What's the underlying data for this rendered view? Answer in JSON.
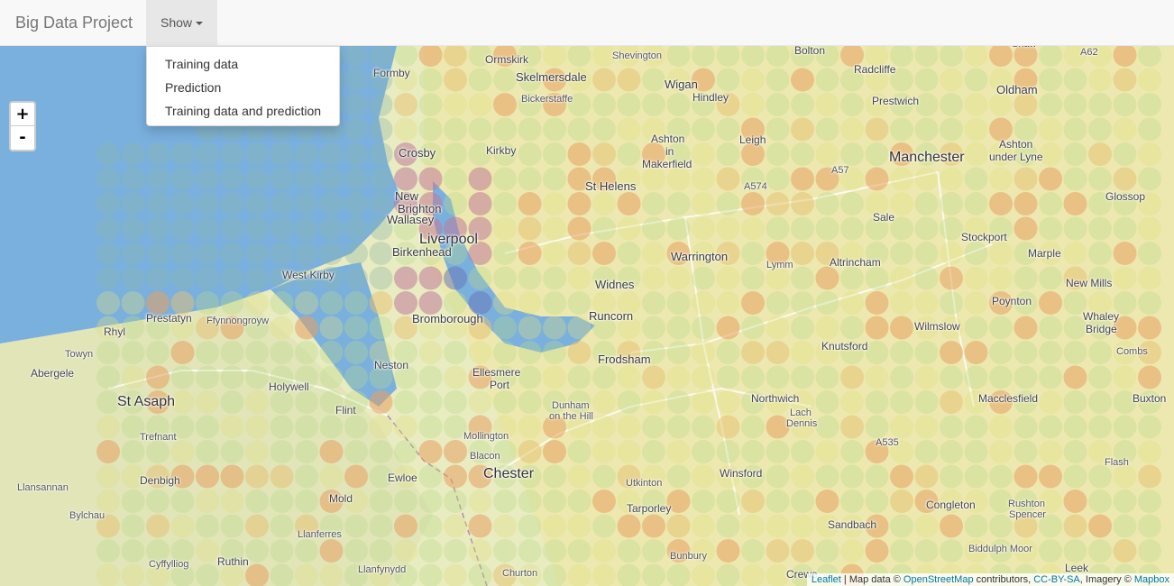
{
  "navbar": {
    "brand": "Big Data Project",
    "show_label": "Show"
  },
  "dropdown": {
    "items": [
      "Training data",
      "Prediction",
      "Training data and prediction"
    ]
  },
  "zoom": {
    "in": "+",
    "out": "-"
  },
  "attribution": {
    "leaflet": "Leaflet",
    "sep1": " | Map data © ",
    "osm": "OpenStreetMap",
    "sep2": " contributors, ",
    "license": "CC-BY-SA",
    "sep3": ", Imagery © ",
    "mapbox": "Mapbox"
  },
  "places": [
    {
      "name": "Bolton",
      "cls": ""
    },
    {
      "name": "Shaw",
      "cls": "sm"
    },
    {
      "name": "Formby",
      "cls": ""
    },
    {
      "name": "Ormskirk",
      "cls": ""
    },
    {
      "name": "Shevington",
      "cls": "sm"
    },
    {
      "name": "Radcliffe",
      "cls": ""
    },
    {
      "name": "Skelmersdale",
      "cls": "med"
    },
    {
      "name": "Wigan",
      "cls": "med"
    },
    {
      "name": "Oldham",
      "cls": "med"
    },
    {
      "name": "Hindley",
      "cls": ""
    },
    {
      "name": "Prestwich",
      "cls": ""
    },
    {
      "name": "Bickerstaffe",
      "cls": "sm"
    },
    {
      "name": "Ashton",
      "cls": ""
    },
    {
      "name": "in",
      "cls": ""
    },
    {
      "name": "Makerfield",
      "cls": ""
    },
    {
      "name": "Leigh",
      "cls": ""
    },
    {
      "name": "Crosby",
      "cls": "med"
    },
    {
      "name": "Kirkby",
      "cls": ""
    },
    {
      "name": "Manchester",
      "cls": "big"
    },
    {
      "name": "Ashton",
      "cls": ""
    },
    {
      "name": "under Lyne",
      "cls": ""
    },
    {
      "name": "St Helens",
      "cls": "med"
    },
    {
      "name": "New",
      "cls": "med"
    },
    {
      "name": "Brighton",
      "cls": "med"
    },
    {
      "name": "Wallasey",
      "cls": "med"
    },
    {
      "name": "Glossop",
      "cls": ""
    },
    {
      "name": "Sale",
      "cls": ""
    },
    {
      "name": "Liverpool",
      "cls": "big"
    },
    {
      "name": "Stockport",
      "cls": ""
    },
    {
      "name": "Birkenhead",
      "cls": "med"
    },
    {
      "name": "Warrington",
      "cls": "med"
    },
    {
      "name": "Lymm",
      "cls": "sm"
    },
    {
      "name": "Altrincham",
      "cls": ""
    },
    {
      "name": "Marple",
      "cls": ""
    },
    {
      "name": "West Kirby",
      "cls": ""
    },
    {
      "name": "Widnes",
      "cls": "med"
    },
    {
      "name": "Poynton",
      "cls": ""
    },
    {
      "name": "New Mills",
      "cls": ""
    },
    {
      "name": "Bromborough",
      "cls": "med"
    },
    {
      "name": "Runcorn",
      "cls": "med"
    },
    {
      "name": "Prestatyn",
      "cls": ""
    },
    {
      "name": "Ffynnongroyw",
      "cls": "sm"
    },
    {
      "name": "Wilmslow",
      "cls": ""
    },
    {
      "name": "Whaley",
      "cls": ""
    },
    {
      "name": "Bridge",
      "cls": ""
    },
    {
      "name": "Rhyl",
      "cls": ""
    },
    {
      "name": "Knutsford",
      "cls": ""
    },
    {
      "name": "Towyn",
      "cls": "sm"
    },
    {
      "name": "Combs",
      "cls": "sm"
    },
    {
      "name": "Frodsham",
      "cls": "med"
    },
    {
      "name": "Abergele",
      "cls": ""
    },
    {
      "name": "Neston",
      "cls": ""
    },
    {
      "name": "Ellesmere",
      "cls": ""
    },
    {
      "name": "Port",
      "cls": ""
    },
    {
      "name": "Holywell",
      "cls": ""
    },
    {
      "name": "Northwich",
      "cls": ""
    },
    {
      "name": "St Asaph",
      "cls": "big"
    },
    {
      "name": "Macclesfield",
      "cls": ""
    },
    {
      "name": "Buxton",
      "cls": ""
    },
    {
      "name": "Flint",
      "cls": ""
    },
    {
      "name": "Dunham",
      "cls": "sm"
    },
    {
      "name": "on the Hill",
      "cls": "sm"
    },
    {
      "name": "Lach",
      "cls": "sm"
    },
    {
      "name": "Dennis",
      "cls": "sm"
    },
    {
      "name": "Trefnant",
      "cls": "sm"
    },
    {
      "name": "Mollington",
      "cls": "sm"
    },
    {
      "name": "Blacon",
      "cls": "sm"
    },
    {
      "name": "Ewloe",
      "cls": ""
    },
    {
      "name": "Chester",
      "cls": "big"
    },
    {
      "name": "Winsford",
      "cls": ""
    },
    {
      "name": "Denbigh",
      "cls": ""
    },
    {
      "name": "Flash",
      "cls": "sm"
    },
    {
      "name": "Utkinton",
      "cls": "sm"
    },
    {
      "name": "Llansannan",
      "cls": "sm"
    },
    {
      "name": "Mold",
      "cls": ""
    },
    {
      "name": "Tarporley",
      "cls": ""
    },
    {
      "name": "Congleton",
      "cls": ""
    },
    {
      "name": "Bylchau",
      "cls": "sm"
    },
    {
      "name": "Rushton",
      "cls": "sm"
    },
    {
      "name": "Spencer",
      "cls": "sm"
    },
    {
      "name": "Sandbach",
      "cls": ""
    },
    {
      "name": "Llanferres",
      "cls": "sm"
    },
    {
      "name": "Bunbury",
      "cls": "sm"
    },
    {
      "name": "Biddulph Moor",
      "cls": "sm"
    },
    {
      "name": "Cyffylliog",
      "cls": "sm"
    },
    {
      "name": "Ruthin",
      "cls": ""
    },
    {
      "name": "Llanfynydd",
      "cls": "sm"
    },
    {
      "name": "Churton",
      "cls": "sm"
    },
    {
      "name": "Crewe",
      "cls": ""
    },
    {
      "name": "Leek",
      "cls": ""
    },
    {
      "name": "A62",
      "cls": "sm"
    },
    {
      "name": "A57",
      "cls": "sm"
    },
    {
      "name": "A574",
      "cls": "sm"
    },
    {
      "name": "A535",
      "cls": "sm"
    }
  ],
  "colors": {
    "sea": "#7ab0de",
    "land": "#e8ecc0",
    "navbar_bg": "#f8f8f8",
    "active_nav": "#e7e7e7",
    "link": "#0078a8"
  }
}
